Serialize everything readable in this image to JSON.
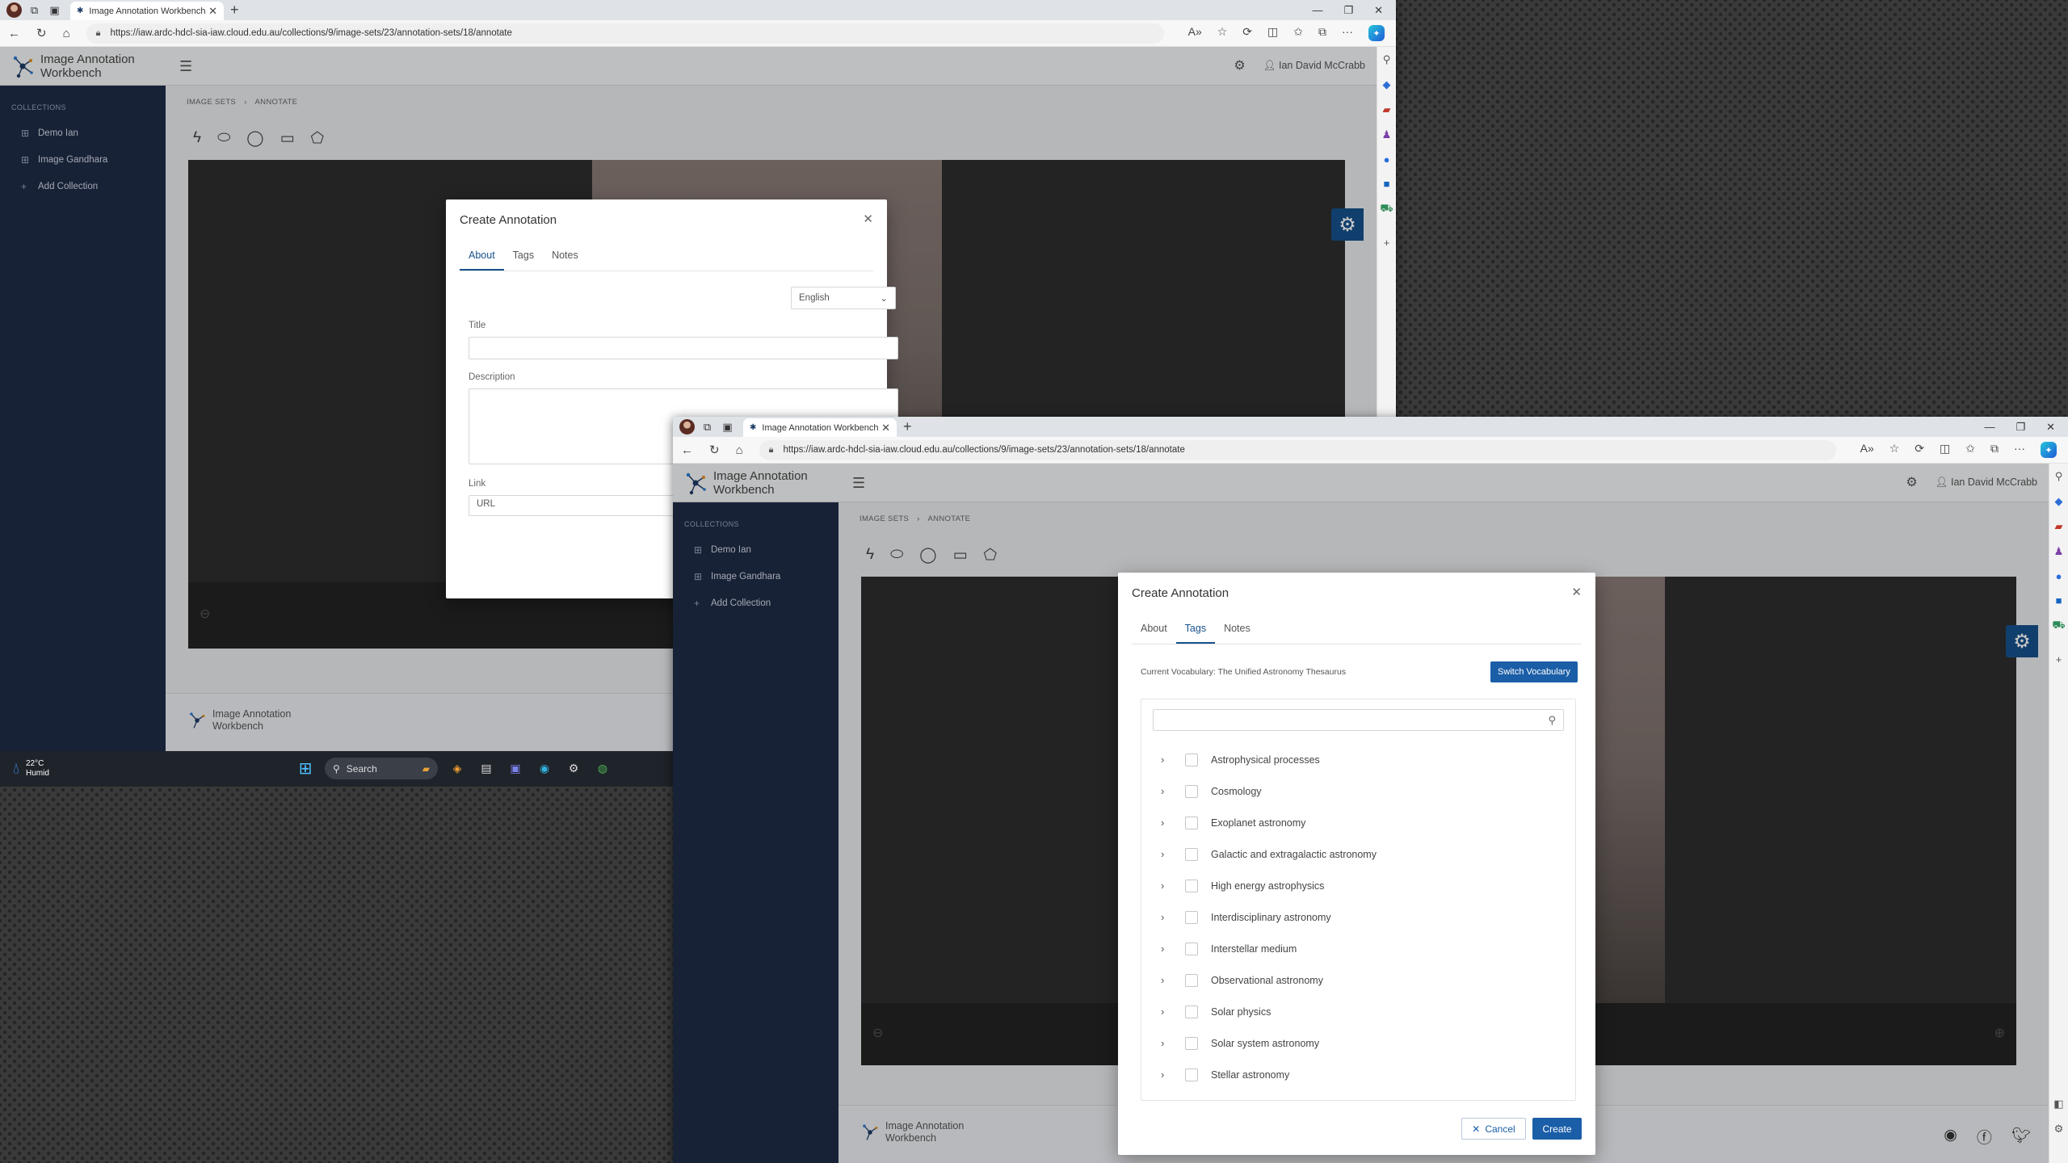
{
  "browser": {
    "tab_title": "Image Annotation Workbench",
    "url1": "https://iaw.ardc-hdcl-sia-iaw.cloud.edu.au/collections/9/image-sets/23/annotation-sets/18/annotate",
    "url2": "https://iaw.ardc-hdcl-sia-iaw.cloud.edu.au/collections/9/image-sets/23/annotation-sets/18/annotate"
  },
  "app": {
    "brand_line1": "Image Annotation",
    "brand_line2": "Workbench",
    "user": "Ian David McCrabb",
    "breadcrumb": [
      "IMAGE SETS",
      "›",
      "ANNOTATE"
    ]
  },
  "sidebar": {
    "heading": "COLLECTIONS",
    "items": [
      {
        "label": "Demo Ian",
        "icon": "grid-icon"
      },
      {
        "label": "Image Gandhara",
        "icon": "grid-icon"
      },
      {
        "label": "Add Collection",
        "icon": "plus-icon"
      }
    ]
  },
  "modal1": {
    "title": "Create Annotation",
    "tabs": [
      "About",
      "Tags",
      "Notes"
    ],
    "active_tab": "About",
    "language": "English",
    "title_label": "Title",
    "description_label": "Description",
    "link_label": "Link",
    "link_placeholder": "URL"
  },
  "modal2": {
    "title": "Create Annotation",
    "tabs": [
      "About",
      "Tags",
      "Notes"
    ],
    "active_tab": "Tags",
    "vocabulary_text": "Current Vocabulary: The Unified Astronomy Thesaurus",
    "switch_vocabulary": "Switch Vocabulary",
    "tags": [
      "Astrophysical processes",
      "Cosmology",
      "Exoplanet astronomy",
      "Galactic and extragalactic astronomy",
      "High energy astrophysics",
      "Interdisciplinary astronomy",
      "Interstellar medium",
      "Observational astronomy",
      "Solar physics",
      "Solar system astronomy",
      "Stellar astronomy"
    ],
    "cancel": "Cancel",
    "create": "Create"
  },
  "taskbar": {
    "temperature": "22°C",
    "weather": "Humid",
    "search": "Search"
  },
  "colors": {
    "sidebar": "#1f2c47",
    "accent": "#17518c",
    "primary_button": "#1b5ea8"
  }
}
